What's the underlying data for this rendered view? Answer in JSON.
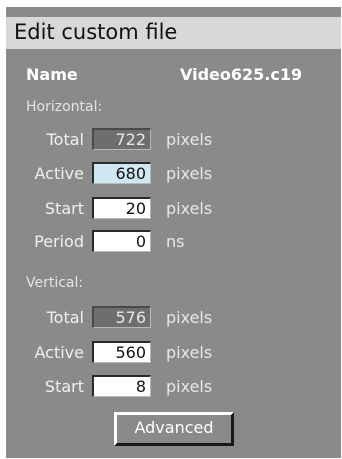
{
  "dialog": {
    "title": "Edit custom file",
    "name_label": "Name",
    "name_value": "Video625.c19"
  },
  "horizontal": {
    "heading": "Horizontal:",
    "rows": [
      {
        "label": "Total",
        "value": "722",
        "unit": "pixels"
      },
      {
        "label": "Active",
        "value": "680",
        "unit": "pixels"
      },
      {
        "label": "Start",
        "value": "20",
        "unit": "pixels"
      },
      {
        "label": "Period",
        "value": "0",
        "unit": "ns"
      }
    ]
  },
  "vertical": {
    "heading": "Vertical:",
    "rows": [
      {
        "label": "Total",
        "value": "576",
        "unit": "pixels"
      },
      {
        "label": "Active",
        "value": "560",
        "unit": "pixels"
      },
      {
        "label": "Start",
        "value": "8",
        "unit": "pixels"
      }
    ]
  },
  "buttons": {
    "advanced": "Advanced"
  },
  "colors": {
    "panel": "#8a8a8a",
    "titlebar": "#d8d8d8",
    "readonly_field": "#6e6e6e",
    "focused_field": "#cfe8f2"
  }
}
